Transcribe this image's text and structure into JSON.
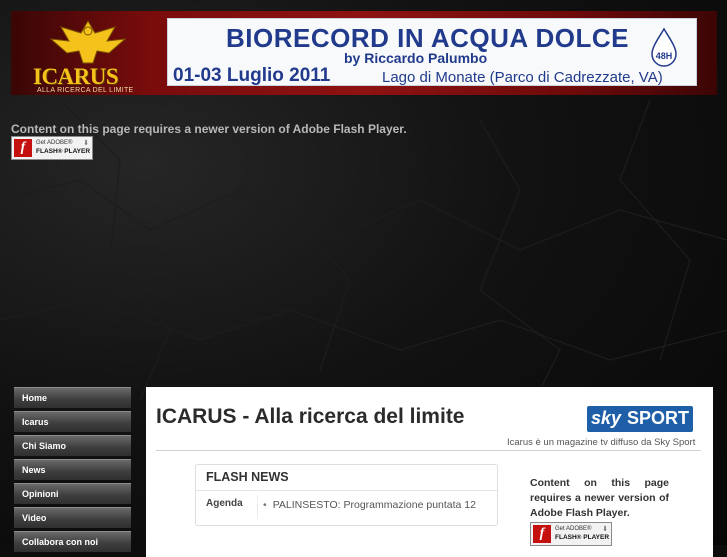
{
  "header": {
    "logo_text": "ICARUS",
    "logo_tagline": "ALLA RICERCA DEL LIMITE",
    "banner": {
      "title": "BIORECORD IN ACQUA DOLCE",
      "subtitle": "by Riccardo Palumbo",
      "dates": "01-03 Luglio 2011",
      "location": "Lago di Monate (Parco di Cadrezzate, VA)",
      "badge": "48H"
    }
  },
  "flash_notice": {
    "message": "Content on this page requires a newer version of Adobe Flash Player.",
    "button_line1": "Get ADOBE®",
    "button_line2": "FLASH® PLAYER",
    "button_mark": "f"
  },
  "nav": {
    "items": [
      {
        "label": "Home"
      },
      {
        "label": "Icarus"
      },
      {
        "label": "Chi Siamo"
      },
      {
        "label": "News"
      },
      {
        "label": "Opinioni"
      },
      {
        "label": "Video"
      },
      {
        "label": "Collabora con noi"
      }
    ]
  },
  "main": {
    "title": "ICARUS - Alla ricerca del limite",
    "sky_logo_sky": "sky",
    "sky_logo_sport": "SPORT",
    "sky_tagline": "Icarus è un magazine tv diffuso da Sky Sport",
    "flash_news": {
      "heading": "FLASH NEWS",
      "label": "Agenda",
      "bullet": "•",
      "item": "PALINSESTO: Programmazione puntata 12"
    },
    "side_flash_message": "Content on this page requires a newer version of Adobe Flash Player."
  },
  "colors": {
    "header_red": "#8e1212",
    "logo_gold": "#f4c21a",
    "banner_blue": "#213a8c",
    "sky_blue": "#1f5fa8",
    "nav_grey": "#4a4a4a"
  }
}
